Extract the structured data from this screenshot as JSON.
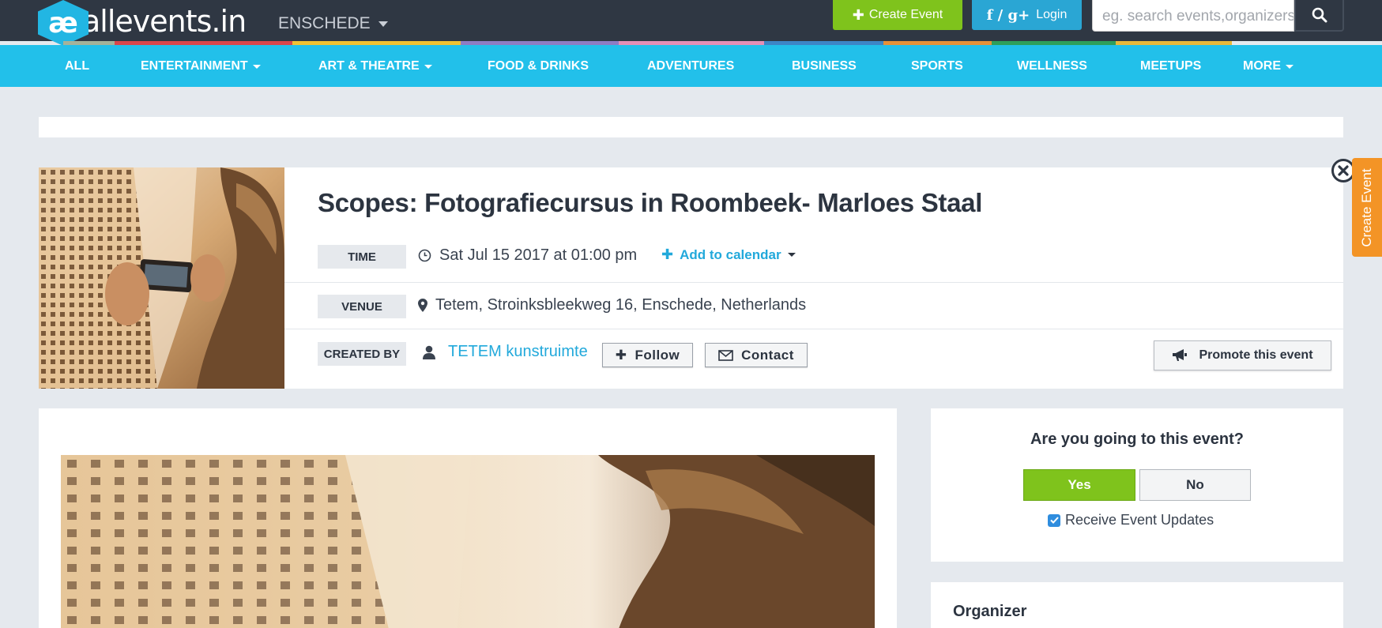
{
  "header": {
    "logo_text": "allevents.in",
    "city": "ENSCHEDE",
    "create_event": "Create Event",
    "login_social": "f / g+",
    "login": "Login",
    "search_placeholder": "eg. search events,organizers"
  },
  "categories": [
    {
      "label": "ALL",
      "dropdown": false
    },
    {
      "label": "ENTERTAINMENT",
      "dropdown": true
    },
    {
      "label": "ART & THEATRE",
      "dropdown": true
    },
    {
      "label": "FOOD & DRINKS",
      "dropdown": false
    },
    {
      "label": "ADVENTURES",
      "dropdown": false
    },
    {
      "label": "BUSINESS",
      "dropdown": false
    },
    {
      "label": "SPORTS",
      "dropdown": false
    },
    {
      "label": "WELLNESS",
      "dropdown": false
    },
    {
      "label": "MEETUPS",
      "dropdown": false
    },
    {
      "label": "MORE",
      "dropdown": true
    }
  ],
  "strip_colors": [
    "#a4b29a",
    "#d9464b",
    "#f1c232",
    "#8e7cc3",
    "#e58fb6",
    "#3d85c6",
    "#e69138",
    "#2e9e5b",
    "#e8b83a"
  ],
  "event": {
    "title": "Scopes: Fotografiecursus in Roombeek- Marloes Staal",
    "time_label": "TIME",
    "time_value": "Sat Jul 15 2017 at 01:00 pm",
    "add_to_calendar": "Add to calendar",
    "venue_label": "VENUE",
    "venue_value": "Tetem, Stroinksbleekweg 16, Enschede, Netherlands",
    "created_by_label": "CREATED BY",
    "creator": "TETEM kunstruimte",
    "follow": "Follow",
    "contact": "Contact",
    "promote": "Promote this event"
  },
  "side_tab": "Create Event",
  "rsvp": {
    "question": "Are you going to this event?",
    "yes": "Yes",
    "no": "No",
    "updates_label": "Receive Event Updates",
    "updates_checked": true
  },
  "organizer": {
    "title": "Organizer"
  },
  "colors": {
    "topbar": "#2f3743",
    "nav": "#22c0ea",
    "green": "#7fc31c",
    "link": "#22a9db",
    "side_tab": "#f39426"
  }
}
